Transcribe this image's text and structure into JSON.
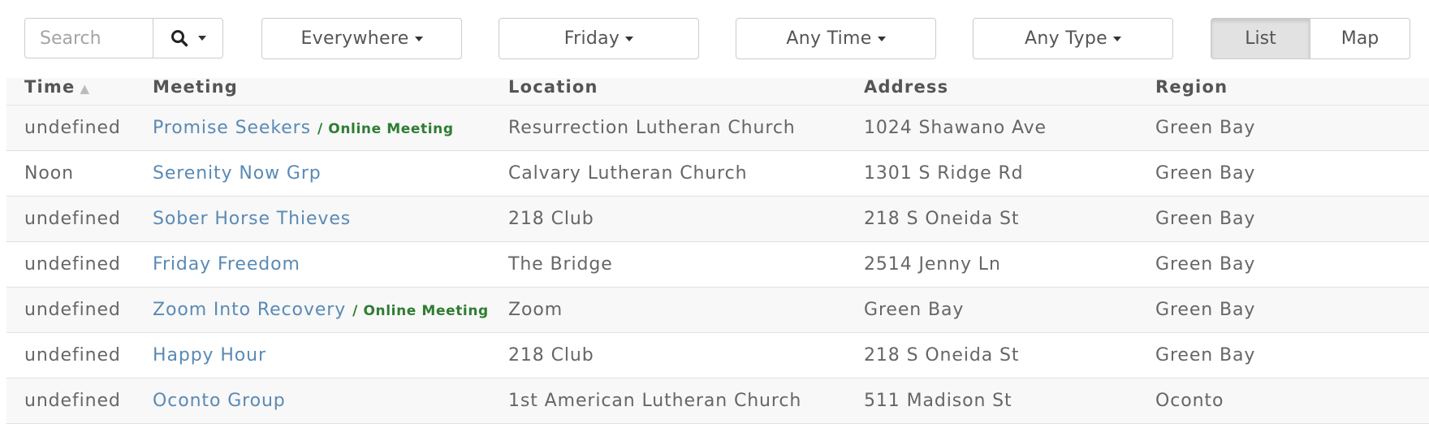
{
  "toolbar": {
    "search_placeholder": "Search",
    "filters": {
      "region": "Everywhere",
      "day": "Friday",
      "time": "Any Time",
      "type": "Any Type"
    },
    "views": {
      "list": "List",
      "map": "Map",
      "active": "List"
    }
  },
  "table": {
    "headers": {
      "time": "Time",
      "meeting": "Meeting",
      "location": "Location",
      "address": "Address",
      "region": "Region"
    },
    "sort": {
      "column": "Time",
      "direction": "ascending"
    },
    "rows": [
      {
        "time": "undefined",
        "meeting": "Promise Seekers",
        "tag": "/ Online Meeting",
        "location": "Resurrection Lutheran Church",
        "address": "1024 Shawano Ave",
        "region": "Green Bay"
      },
      {
        "time": "Noon",
        "meeting": "Serenity Now Grp",
        "tag": "",
        "location": "Calvary Lutheran Church",
        "address": "1301 S Ridge Rd",
        "region": "Green Bay"
      },
      {
        "time": "undefined",
        "meeting": "Sober Horse Thieves",
        "tag": "",
        "location": "218 Club",
        "address": "218 S Oneida St",
        "region": "Green Bay"
      },
      {
        "time": "undefined",
        "meeting": "Friday Freedom",
        "tag": "",
        "location": "The Bridge",
        "address": "2514 Jenny Ln",
        "region": "Green Bay"
      },
      {
        "time": "undefined",
        "meeting": "Zoom Into Recovery",
        "tag": "/ Online Meeting",
        "location": "Zoom",
        "address": "Green Bay",
        "region": "Green Bay"
      },
      {
        "time": "undefined",
        "meeting": "Happy Hour",
        "tag": "",
        "location": "218 Club",
        "address": "218 S Oneida St",
        "region": "Green Bay"
      },
      {
        "time": "undefined",
        "meeting": "Oconto Group",
        "tag": "",
        "location": "1st American Lutheran Church",
        "address": "511 Madison St",
        "region": "Oconto"
      }
    ]
  },
  "colors": {
    "link": "#5a8ab5",
    "online_tag": "#2e7d32",
    "active_toggle": "#e2e2e2"
  },
  "icons": {
    "search": "search-icon",
    "dropdown": "caret-down-icon",
    "sort": "sort-up-icon"
  }
}
